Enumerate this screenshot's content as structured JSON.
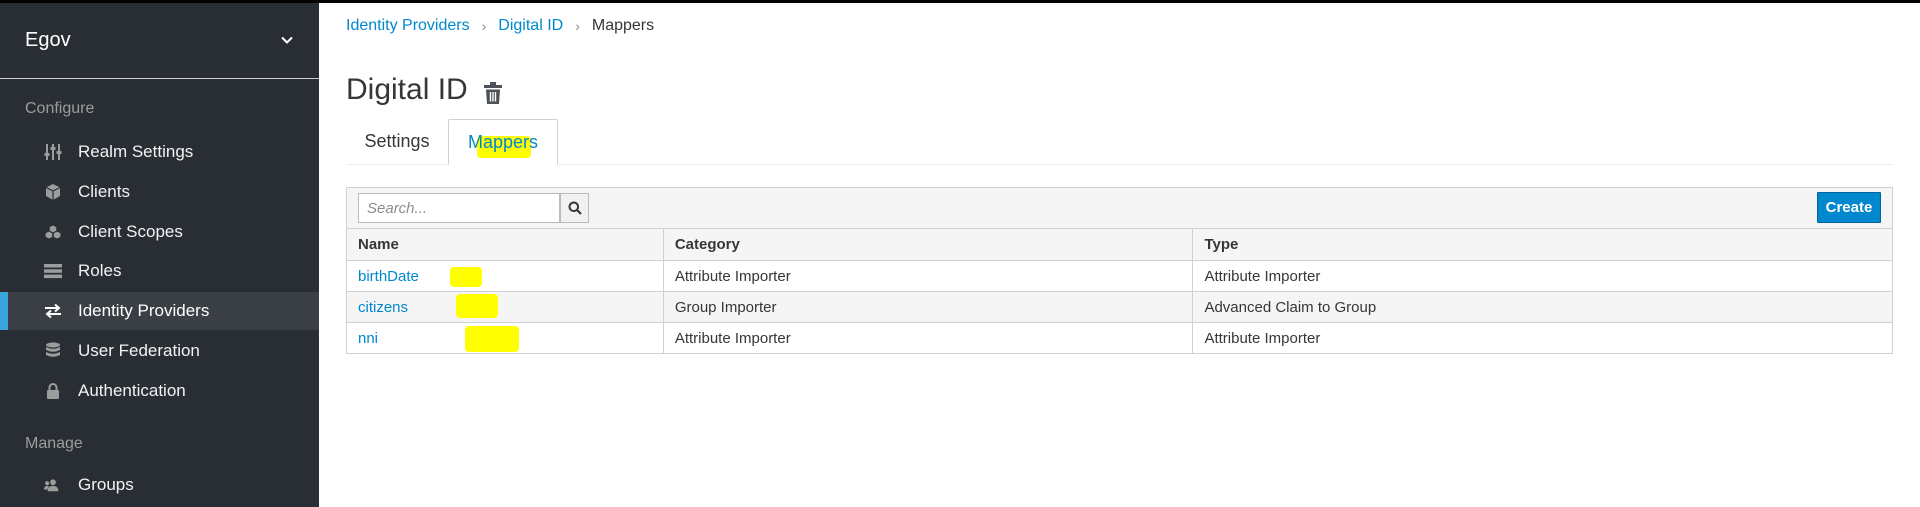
{
  "sidebar": {
    "realm": "Egov",
    "configure_label": "Configure",
    "manage_label": "Manage",
    "items": [
      {
        "label": "Realm Settings",
        "icon": "sliders-icon"
      },
      {
        "label": "Clients",
        "icon": "cube-icon"
      },
      {
        "label": "Client Scopes",
        "icon": "cubes-icon"
      },
      {
        "label": "Roles",
        "icon": "list-icon"
      },
      {
        "label": "Identity Providers",
        "icon": "exchange-icon",
        "active": true
      },
      {
        "label": "User Federation",
        "icon": "database-icon"
      },
      {
        "label": "Authentication",
        "icon": "lock-icon"
      }
    ],
    "manage_items": [
      {
        "label": "Groups",
        "icon": "users-icon"
      }
    ]
  },
  "breadcrumb": [
    "Identity Providers",
    "Digital ID",
    "Mappers"
  ],
  "page": {
    "title": "Digital ID",
    "tabs": [
      "Settings",
      "Mappers"
    ],
    "active_tab": "Mappers"
  },
  "toolbar": {
    "search_placeholder": "Search...",
    "create_label": "Create"
  },
  "table": {
    "columns": [
      "Name",
      "Category",
      "Type"
    ],
    "rows": [
      {
        "name": "birthDate",
        "category": "Attribute Importer",
        "type": "Attribute Importer"
      },
      {
        "name": "citizens",
        "category": "Group Importer",
        "type": "Advanced Claim to Group"
      },
      {
        "name": "nni",
        "category": "Attribute Importer",
        "type": "Attribute Importer"
      }
    ]
  },
  "colors": {
    "sidebar_bg": "#292e34",
    "accent": "#0088ce",
    "active_bar": "#39a5dc",
    "highlight": "#ffff00"
  }
}
